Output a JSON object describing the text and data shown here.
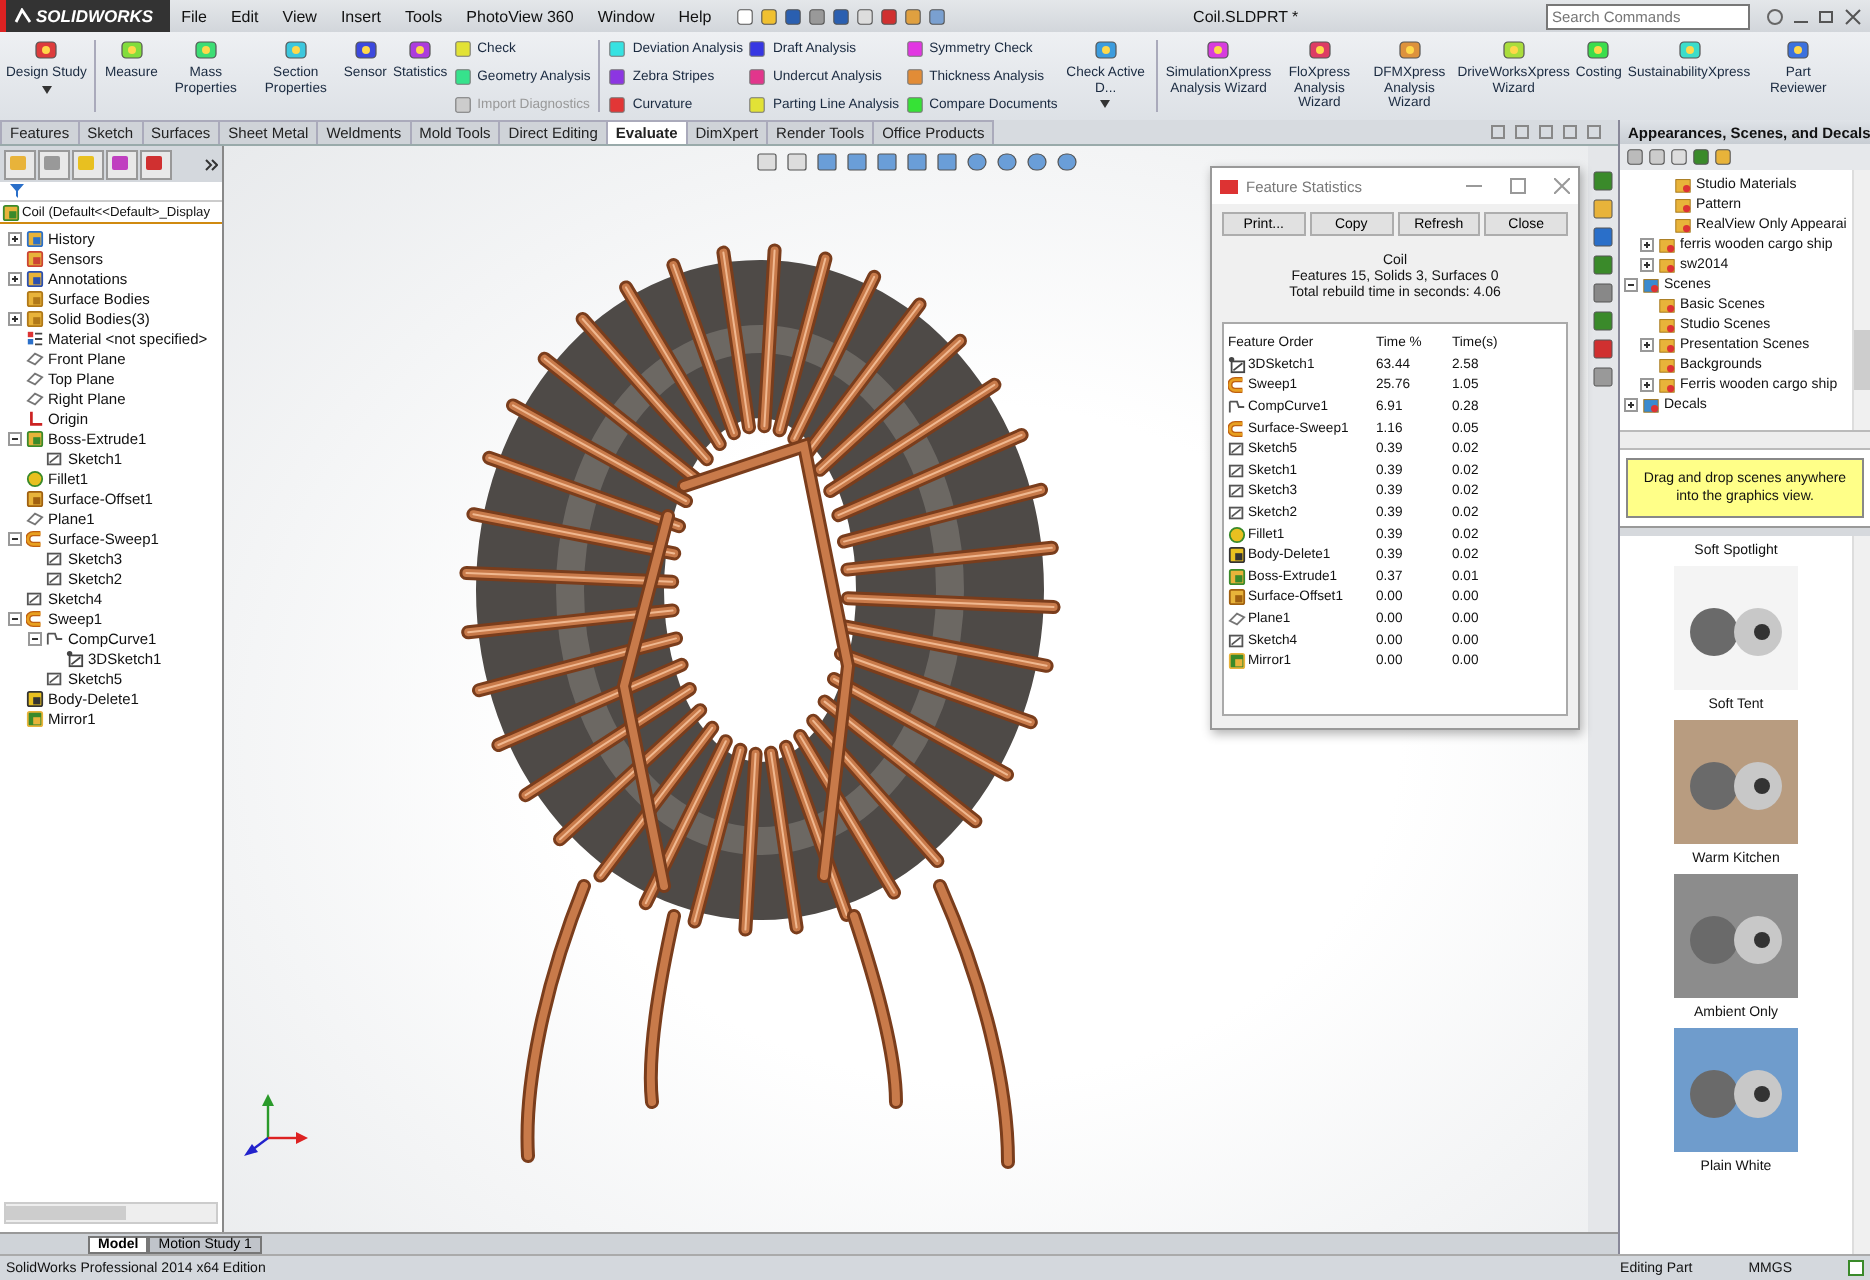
{
  "title_bar": {
    "app": "SOLIDWORKS",
    "menus": [
      "File",
      "Edit",
      "View",
      "Insert",
      "Tools",
      "PhotoView 360",
      "Window",
      "Help"
    ],
    "document_title": "Coil.SLDPRT *",
    "search": {
      "placeholder": "Search Commands"
    }
  },
  "ribbon": [
    {
      "kind": "large",
      "label": "Design Study",
      "caret": true
    },
    {
      "kind": "separator"
    },
    {
      "kind": "large",
      "label": "Measure",
      "caret": false
    },
    {
      "kind": "large",
      "label": "Mass Properties",
      "caret": false
    },
    {
      "kind": "large",
      "label": "Section Properties",
      "caret": false
    },
    {
      "kind": "large",
      "label": "Sensor",
      "caret": false
    },
    {
      "kind": "large",
      "label": "Statistics",
      "caret": false
    },
    {
      "kind": "stack",
      "items": [
        {
          "label": "Check",
          "disabled": false
        },
        {
          "label": "Geometry Analysis",
          "disabled": false
        },
        {
          "label": "Import Diagnostics",
          "disabled": true
        }
      ]
    },
    {
      "kind": "separator"
    },
    {
      "kind": "stack",
      "items": [
        {
          "label": "Deviation Analysis",
          "disabled": false
        },
        {
          "label": "Zebra Stripes",
          "disabled": false
        },
        {
          "label": "Curvature",
          "disabled": false
        }
      ]
    },
    {
      "kind": "stack",
      "items": [
        {
          "label": "Draft Analysis",
          "disabled": false
        },
        {
          "label": "Undercut Analysis",
          "disabled": false
        },
        {
          "label": "Parting Line Analysis",
          "disabled": false
        }
      ]
    },
    {
      "kind": "stack",
      "items": [
        {
          "label": "Symmetry Check",
          "disabled": false
        },
        {
          "label": "Thickness Analysis",
          "disabled": false
        },
        {
          "label": "Compare Documents",
          "disabled": false
        }
      ]
    },
    {
      "kind": "large",
      "label": "Check Active D...",
      "caret": true
    },
    {
      "kind": "separator"
    },
    {
      "kind": "large",
      "label": "SimulationXpress Analysis Wizard",
      "caret": false
    },
    {
      "kind": "large",
      "label": "FloXpress Analysis Wizard",
      "caret": false
    },
    {
      "kind": "large",
      "label": "DFMXpress Analysis Wizard",
      "caret": false
    },
    {
      "kind": "large",
      "label": "DriveWorksXpress Wizard",
      "caret": false
    },
    {
      "kind": "large",
      "label": "Costing",
      "caret": false
    },
    {
      "kind": "large",
      "label": "SustainabilityXpress",
      "caret": false
    },
    {
      "kind": "large",
      "label": "Part Reviewer",
      "caret": false
    }
  ],
  "tabs": [
    {
      "label": "Features",
      "selected": false
    },
    {
      "label": "Sketch",
      "selected": false
    },
    {
      "label": "Surfaces",
      "selected": false
    },
    {
      "label": "Sheet Metal",
      "selected": false
    },
    {
      "label": "Weldments",
      "selected": false
    },
    {
      "label": "Mold Tools",
      "selected": false
    },
    {
      "label": "Direct Editing",
      "selected": false
    },
    {
      "label": "Evaluate",
      "selected": true
    },
    {
      "label": "DimXpert",
      "selected": false
    },
    {
      "label": "Render Tools",
      "selected": false
    },
    {
      "label": "Office Products",
      "selected": false
    }
  ],
  "feature_tree": {
    "root": "Coil  (Default<<Default>_Display",
    "items": [
      {
        "label": "History",
        "kind": "history",
        "expanded": false
      },
      {
        "label": "Sensors",
        "kind": "sensor"
      },
      {
        "label": "Annotations",
        "kind": "annotation",
        "expanded": false
      },
      {
        "label": "Surface Bodies",
        "kind": "bodies"
      },
      {
        "label": "Solid Bodies(3)",
        "kind": "bodies",
        "expanded": false
      },
      {
        "label": "Material <not specified>",
        "kind": "material"
      },
      {
        "label": "Front Plane",
        "kind": "plane"
      },
      {
        "label": "Top Plane",
        "kind": "plane"
      },
      {
        "label": "Right Plane",
        "kind": "plane"
      },
      {
        "label": "Origin",
        "kind": "origin"
      },
      {
        "label": "Boss-Extrude1",
        "kind": "extrude",
        "expanded": true,
        "children": [
          {
            "label": "Sketch1",
            "kind": "sketch"
          }
        ]
      },
      {
        "label": "Fillet1",
        "kind": "fillet"
      },
      {
        "label": "Surface-Offset1",
        "kind": "offset"
      },
      {
        "label": "Plane1",
        "kind": "plane"
      },
      {
        "label": "Surface-Sweep1",
        "kind": "sweep",
        "expanded": true,
        "children": [
          {
            "label": "Sketch3",
            "kind": "sketch"
          },
          {
            "label": "Sketch2",
            "kind": "sketch"
          }
        ]
      },
      {
        "label": "Sketch4",
        "kind": "sketch"
      },
      {
        "label": "Sweep1",
        "kind": "sweep",
        "expanded": true,
        "children": [
          {
            "label": "CompCurve1",
            "kind": "curve",
            "expanded": true,
            "children": [
              {
                "label": "3DSketch1",
                "kind": "sketch3d"
              }
            ]
          },
          {
            "label": "Sketch5",
            "kind": "sketch"
          }
        ]
      },
      {
        "label": "Body-Delete1",
        "kind": "delete"
      },
      {
        "label": "Mirror1",
        "kind": "mirror"
      }
    ]
  },
  "statistics": {
    "title": "Feature Statistics",
    "buttons": [
      "Print...",
      "Copy",
      "Refresh",
      "Close"
    ],
    "summary": [
      "Coil",
      "Features 15, Solids 3, Surfaces 0",
      "Total rebuild time in seconds: 4.06"
    ],
    "columns": [
      "Feature Order",
      "Time %",
      "Time(s)"
    ],
    "rows": [
      {
        "feature": "3DSketch1",
        "kind": "sketch3d",
        "percent": "63.44",
        "seconds": "2.58"
      },
      {
        "feature": "Sweep1",
        "kind": "sweep",
        "percent": "25.76",
        "seconds": "1.05"
      },
      {
        "feature": "CompCurve1",
        "kind": "curve",
        "percent": "6.91",
        "seconds": "0.28"
      },
      {
        "feature": "Surface-Sweep1",
        "kind": "sweep",
        "percent": "1.16",
        "seconds": "0.05"
      },
      {
        "feature": "Sketch5",
        "kind": "sketch",
        "percent": "0.39",
        "seconds": "0.02"
      },
      {
        "feature": "Sketch1",
        "kind": "sketch",
        "percent": "0.39",
        "seconds": "0.02"
      },
      {
        "feature": "Sketch3",
        "kind": "sketch",
        "percent": "0.39",
        "seconds": "0.02"
      },
      {
        "feature": "Sketch2",
        "kind": "sketch",
        "percent": "0.39",
        "seconds": "0.02"
      },
      {
        "feature": "Fillet1",
        "kind": "fillet",
        "percent": "0.39",
        "seconds": "0.02"
      },
      {
        "feature": "Body-Delete1",
        "kind": "delete",
        "percent": "0.39",
        "seconds": "0.02"
      },
      {
        "feature": "Boss-Extrude1",
        "kind": "extrude",
        "percent": "0.37",
        "seconds": "0.01"
      },
      {
        "feature": "Surface-Offset1",
        "kind": "offset",
        "percent": "0.00",
        "seconds": "0.00"
      },
      {
        "feature": "Plane1",
        "kind": "plane",
        "percent": "0.00",
        "seconds": "0.00"
      },
      {
        "feature": "Sketch4",
        "kind": "sketch",
        "percent": "0.00",
        "seconds": "0.00"
      },
      {
        "feature": "Mirror1",
        "kind": "mirror",
        "percent": "0.00",
        "seconds": "0.00"
      }
    ]
  },
  "task_pane": {
    "title": "Appearances, Scenes, and Decals",
    "tree": [
      {
        "children": [
          {
            "children": [
              {
                "label": "Studio Materials"
              },
              {
                "label": "Pattern"
              },
              {
                "label": "RealView Only Appearai"
              }
            ]
          },
          {
            "label": "ferris wooden cargo ship",
            "expanded": false
          },
          {
            "label": "sw2014",
            "expanded": false
          }
        ]
      },
      {
        "label": "Scenes",
        "expanded": true,
        "children": [
          {
            "label": "Basic Scenes"
          },
          {
            "label": "Studio Scenes"
          },
          {
            "label": "Presentation Scenes",
            "expanded": false
          },
          {
            "label": "Backgrounds"
          },
          {
            "label": "Ferris wooden cargo ship",
            "expanded": false
          }
        ]
      },
      {
        "label": "Decals",
        "expanded": false
      }
    ],
    "hint": "Drag and drop scenes anywhere into the graphics view.",
    "scenes": [
      {
        "label": "Soft Spotlight"
      },
      {
        "label": "Soft Tent",
        "color": "#f4f4f4"
      },
      {
        "label": "Warm Kitchen",
        "color": "#b89c80"
      },
      {
        "label": "Ambient Only",
        "color": "#8c8c8c"
      },
      {
        "label": "Plain White",
        "color": "#6f9ccc"
      }
    ]
  },
  "bottom_tabs": [
    {
      "label": "Model",
      "selected": true
    },
    {
      "label": "Motion Study 1",
      "selected": false
    }
  ],
  "status_bar": {
    "edition": "SolidWorks Professional 2014 x64 Edition",
    "mode": "Editing Part",
    "units": "MMGS"
  }
}
